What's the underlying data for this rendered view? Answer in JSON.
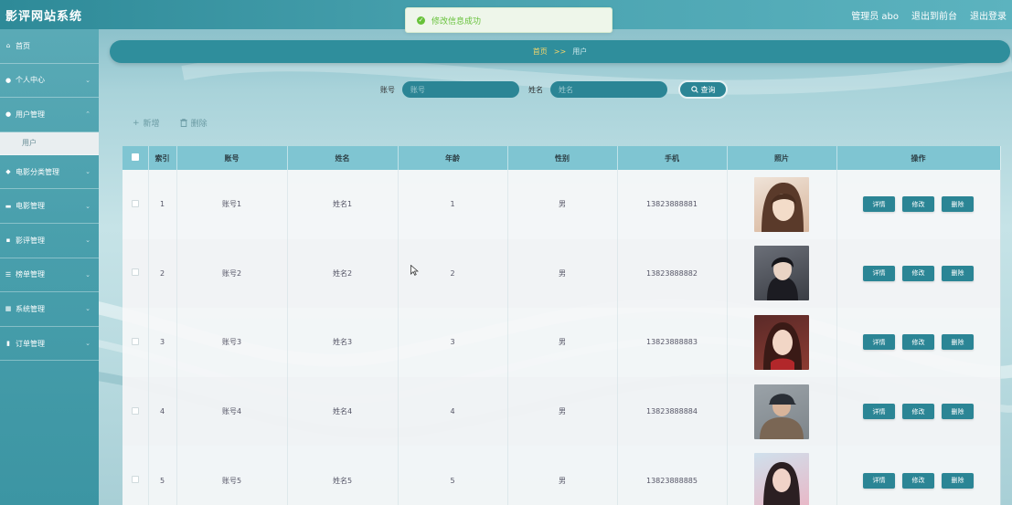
{
  "app": {
    "title": "影评网站系统"
  },
  "topbar": {
    "admin": "管理员 abo",
    "back_to_frontend": "退出到前台",
    "logout": "退出登录"
  },
  "toast": {
    "message": "修改信息成功"
  },
  "sidebar": {
    "items": [
      {
        "label": "首页",
        "icon": "home-icon",
        "glyph": "⌂",
        "chevron": false
      },
      {
        "label": "个人中心",
        "icon": "user-icon",
        "glyph": "●",
        "chevron": true
      },
      {
        "label": "用户管理",
        "icon": "user-icon",
        "glyph": "●",
        "chevron": true,
        "expanded": true
      },
      {
        "label": "电影分类管理",
        "icon": "pin-icon",
        "glyph": "◆",
        "chevron": true
      },
      {
        "label": "电影管理",
        "icon": "folder-icon",
        "glyph": "▬",
        "chevron": true
      },
      {
        "label": "影评管理",
        "icon": "book-icon",
        "glyph": "▪",
        "chevron": true
      },
      {
        "label": "榜单管理",
        "icon": "list-icon",
        "glyph": "☰",
        "chevron": true
      },
      {
        "label": "系统管理",
        "icon": "grid-icon",
        "glyph": "▦",
        "chevron": true
      },
      {
        "label": "订单管理",
        "icon": "bar-chart-icon",
        "glyph": "▮",
        "chevron": true
      }
    ],
    "submenu": {
      "label": "用户"
    }
  },
  "breadcrumb": {
    "home": "首页",
    "separator": ">>",
    "current": "用户"
  },
  "search": {
    "account_label": "账号",
    "account_placeholder": "账号",
    "name_label": "姓名",
    "name_placeholder": "姓名",
    "button_label": "查询"
  },
  "actions": {
    "add": "新增",
    "delete": "删除"
  },
  "table": {
    "columns": [
      "",
      "索引",
      "账号",
      "姓名",
      "年龄",
      "性别",
      "手机",
      "照片",
      "操作"
    ],
    "buttons": {
      "detail": "详情",
      "edit": "修改",
      "delete": "删除"
    },
    "rows": [
      {
        "index": "1",
        "account": "账号1",
        "name": "姓名1",
        "age": "1",
        "gender": "男",
        "phone": "13823888881"
      },
      {
        "index": "2",
        "account": "账号2",
        "name": "姓名2",
        "age": "2",
        "gender": "男",
        "phone": "13823888882"
      },
      {
        "index": "3",
        "account": "账号3",
        "name": "姓名3",
        "age": "3",
        "gender": "男",
        "phone": "13823888883"
      },
      {
        "index": "4",
        "account": "账号4",
        "name": "姓名4",
        "age": "4",
        "gender": "男",
        "phone": "13823888884"
      },
      {
        "index": "5",
        "account": "账号5",
        "name": "姓名5",
        "age": "5",
        "gender": "男",
        "phone": "13823888885"
      }
    ]
  },
  "colors": {
    "primary": "#2b8595",
    "header_row": "#7fc5d2",
    "toast_success": "#67c23a",
    "crumb_text": "#f5d66a"
  }
}
